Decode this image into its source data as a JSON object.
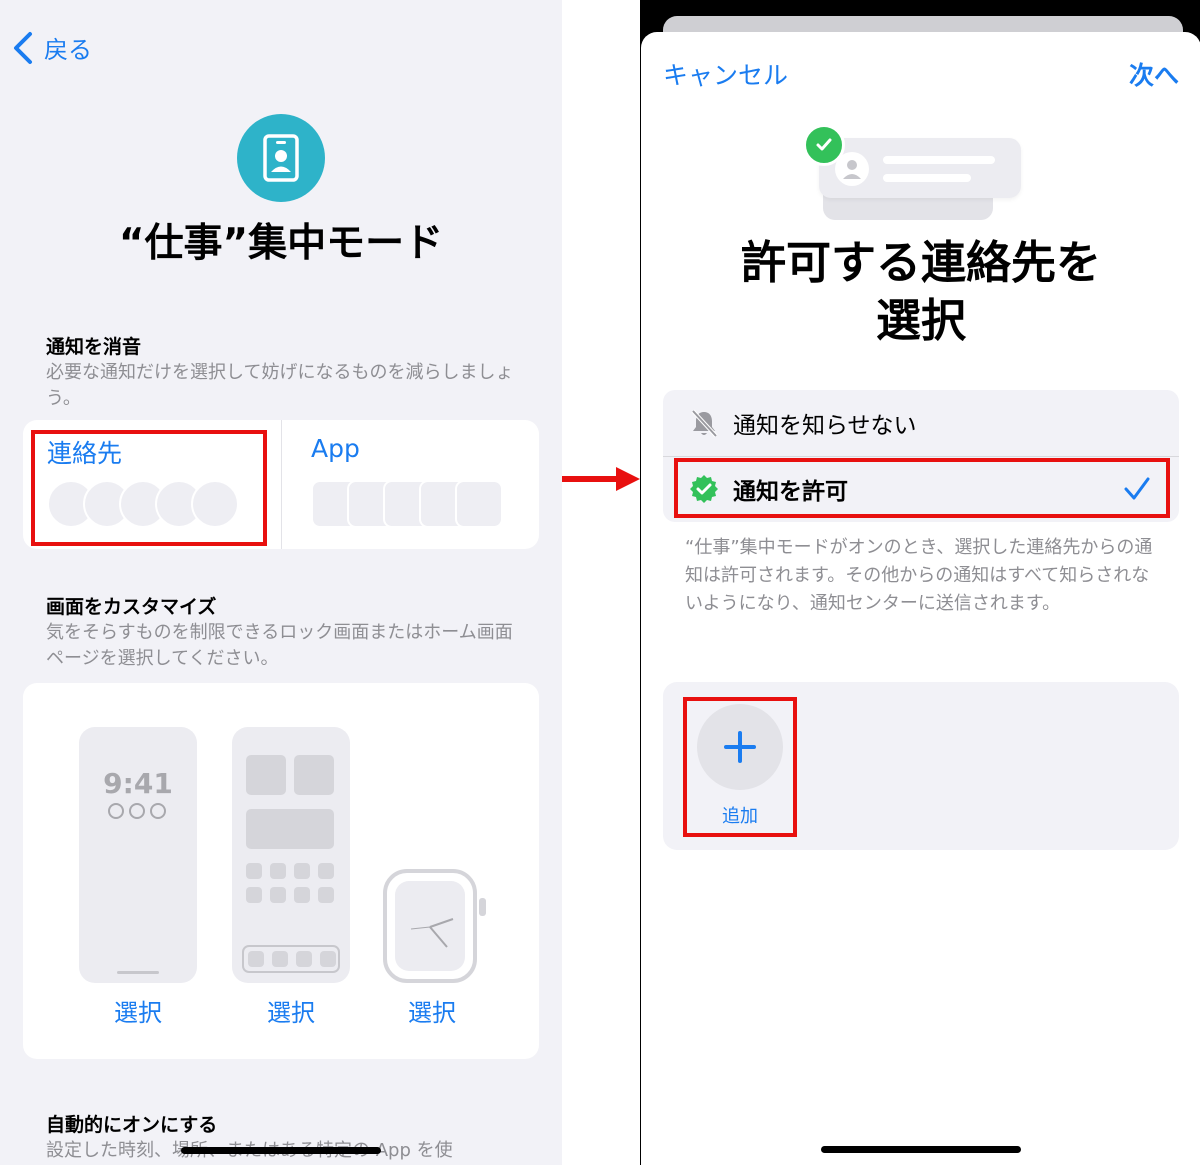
{
  "left": {
    "back_label": "戻る",
    "mode_title": "“仕事”集中モード",
    "silence": {
      "heading": "通知を消音",
      "subtitle": "必要な通知だけを選択して妨げになるものを減らしましょう。",
      "contacts_label": "連絡先",
      "app_label": "App"
    },
    "customize": {
      "heading": "画面をカスタマイズ",
      "subtitle": "気をそらすものを制限できるロック画面またはホーム画面ページを選択してください。",
      "lock_time": "9:41",
      "select_labels": [
        "選択",
        "選択",
        "選択"
      ]
    },
    "auto": {
      "heading": "自動的にオンにする",
      "subtitle": "設定した時刻、場所、またはある特定の App を使"
    }
  },
  "right": {
    "cancel_label": "キャンセル",
    "next_label": "次へ",
    "title": "許可する連絡先を選択",
    "options": [
      {
        "label": "通知を知らせない",
        "icon": "bell-slash-icon",
        "selected": false
      },
      {
        "label": "通知を許可",
        "icon": "green-check-badge-icon",
        "selected": true
      }
    ],
    "description": "“仕事”集中モードがオンのとき、選択した連絡先からの通知は許可されます。その他からの通知はすべて知らされないようになり、通知センターに送信されます。",
    "add_label": "追加"
  },
  "colors": {
    "accent": "#1a7cf0",
    "highlight": "#e8100f",
    "mode_icon": "#2eb3c9",
    "success": "#33c15a"
  }
}
